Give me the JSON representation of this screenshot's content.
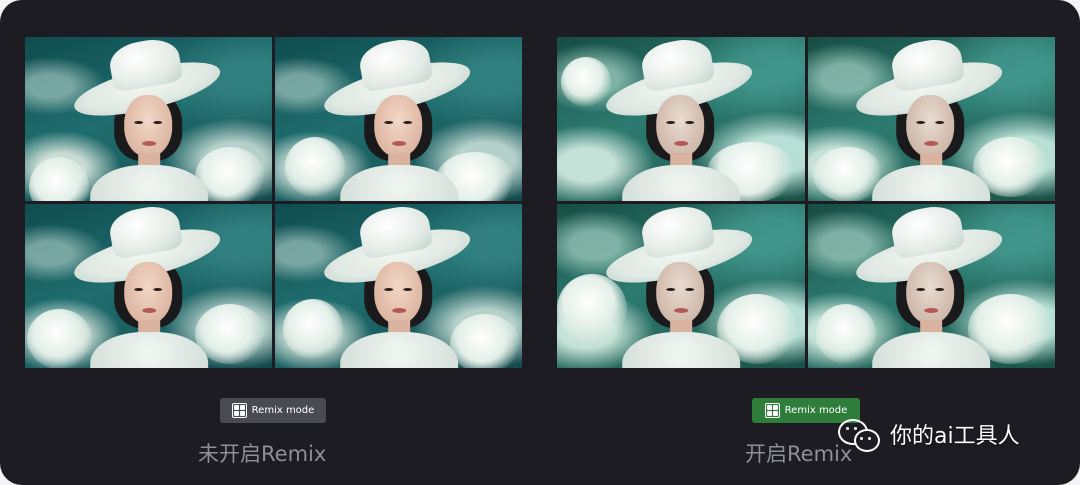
{
  "comparison": {
    "left": {
      "badge_label": "Remix mode",
      "badge_icon": "grid-icon",
      "caption": "未开启Remix",
      "badge_color": "#4a4b52"
    },
    "right": {
      "badge_label": "Remix mode",
      "badge_icon": "grid-icon",
      "caption": "开启Remix",
      "badge_color": "#2e7d3a"
    }
  },
  "watermark": {
    "icon": "wechat-icon",
    "text": "你的ai工具人"
  }
}
